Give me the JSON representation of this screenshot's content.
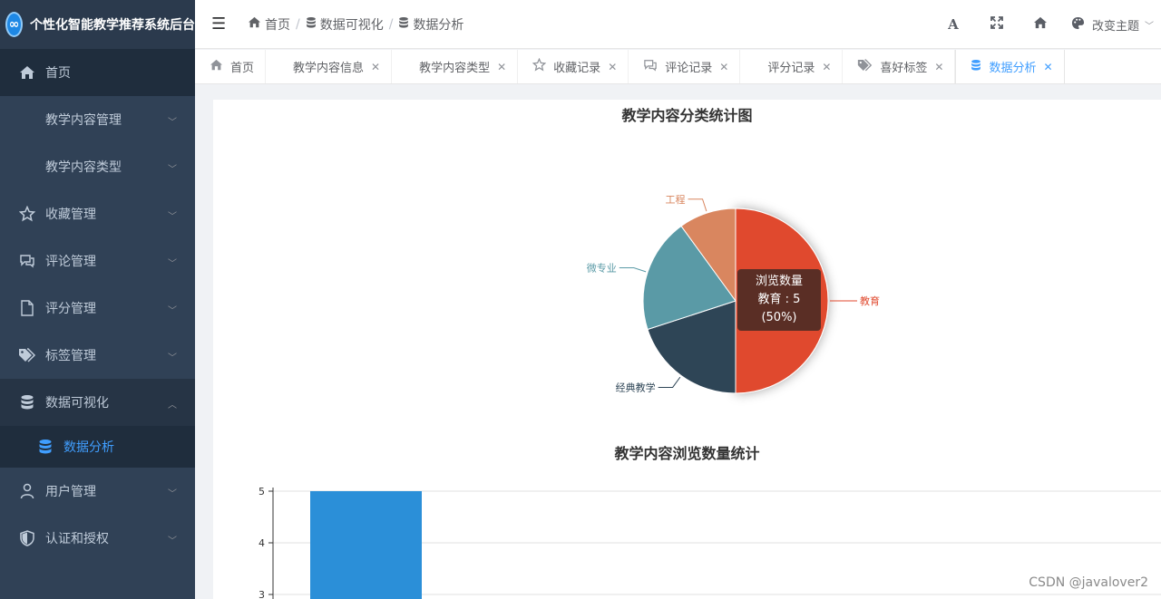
{
  "app": {
    "title": "个性化智能教学推荐系统后台"
  },
  "sidebar": {
    "items": [
      {
        "label": "首页"
      },
      {
        "label": "教学内容管理"
      },
      {
        "label": "教学内容类型"
      },
      {
        "label": "收藏管理"
      },
      {
        "label": "评论管理"
      },
      {
        "label": "评分管理"
      },
      {
        "label": "标签管理"
      },
      {
        "label": "数据可视化"
      },
      {
        "label": "数据分析"
      },
      {
        "label": "用户管理"
      },
      {
        "label": "认证和授权"
      }
    ]
  },
  "header": {
    "breadcrumb": [
      "首页",
      "数据可视化",
      "数据分析"
    ],
    "theme_label": "改变主题"
  },
  "tags": [
    {
      "label": "首页"
    },
    {
      "label": "教学内容信息"
    },
    {
      "label": "教学内容类型"
    },
    {
      "label": "收藏记录"
    },
    {
      "label": "评论记录"
    },
    {
      "label": "评分记录"
    },
    {
      "label": "喜好标签"
    },
    {
      "label": "数据分析"
    }
  ],
  "tooltip": {
    "series": "浏览数量",
    "text": "教育 : 5 (50%)"
  },
  "watermark": "CSDN @javalover2",
  "chart_data": [
    {
      "type": "pie",
      "title": "教学内容分类统计图",
      "slices": [
        {
          "name": "教育",
          "value": 5,
          "color": "#e04a2f"
        },
        {
          "name": "经典教学",
          "value": 2,
          "color": "#2e4556"
        },
        {
          "name": "微专业",
          "value": 2,
          "color": "#5a9aa6"
        },
        {
          "name": "工程",
          "value": 1,
          "color": "#d9865f"
        }
      ]
    },
    {
      "type": "bar",
      "title": "教学内容浏览数量统计",
      "y_ticks": [
        "5",
        "4",
        "3"
      ],
      "values": [
        5
      ],
      "color": "#2b8fd8"
    }
  ]
}
